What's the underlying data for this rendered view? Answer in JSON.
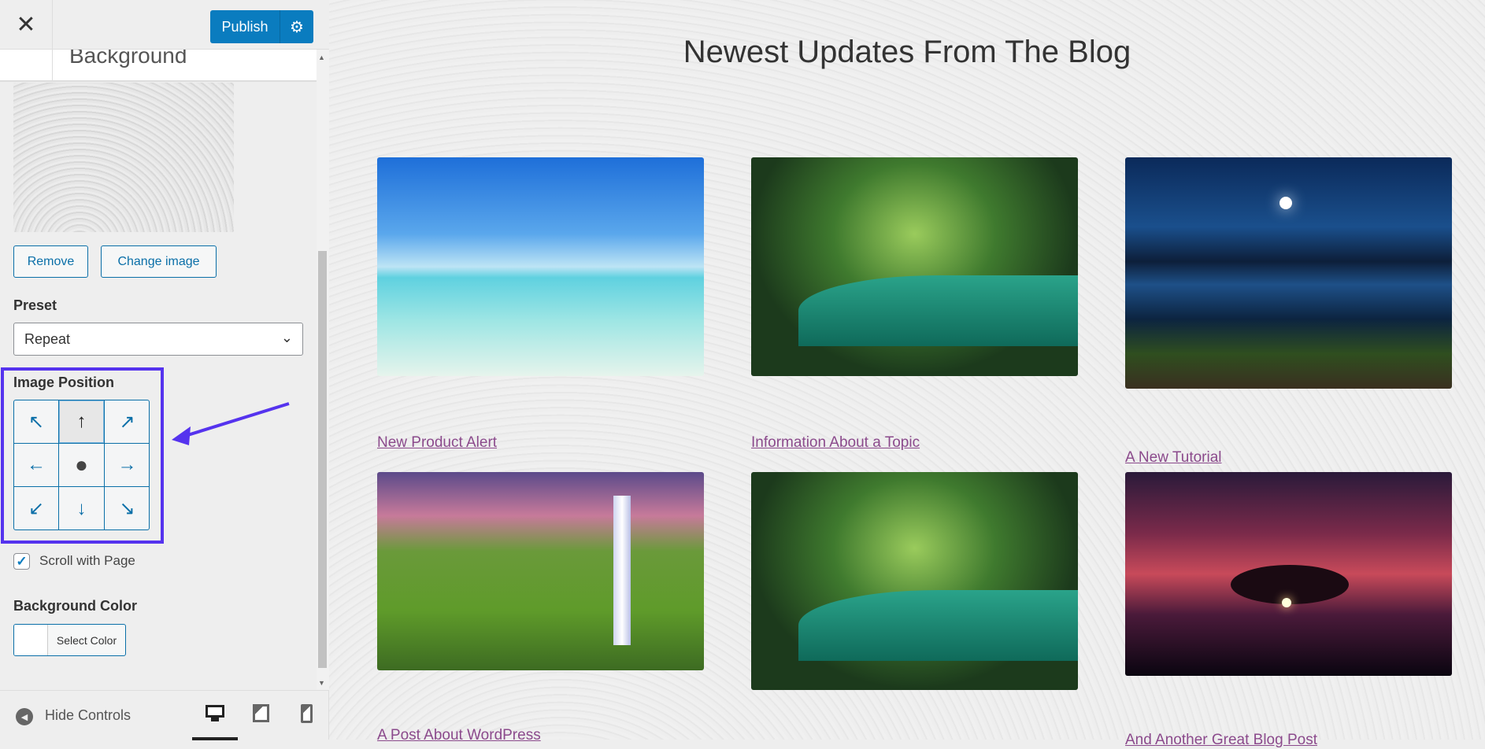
{
  "sidebar": {
    "close_icon": "close-icon",
    "publish_label": "Publish",
    "section_title": "Background",
    "remove_label": "Remove",
    "change_image_label": "Change image",
    "preset_label": "Preset",
    "preset_value": "Repeat",
    "image_position_label": "Image Position",
    "image_position_selected": "top-center",
    "position_cells": [
      "↖",
      "↑",
      "↗",
      "←",
      "●",
      "→",
      "↙",
      "↓",
      "↘"
    ],
    "scroll_with_page_label": "Scroll with Page",
    "scroll_with_page_checked": true,
    "background_color_label": "Background Color",
    "select_color_label": "Select Color",
    "hide_controls_label": "Hide Controls",
    "devices": [
      "desktop",
      "tablet",
      "mobile"
    ],
    "active_device": "desktop"
  },
  "annotation": {
    "highlight_color": "#5533ee"
  },
  "preview": {
    "heading": "Newest Updates From The Blog",
    "posts": [
      {
        "title": "New Product Alert",
        "image": "tropical beach"
      },
      {
        "title": "Information About a Topic",
        "image": "forest river"
      },
      {
        "title": "A New Tutorial",
        "image": "lake pier at night"
      },
      {
        "title": "A Post About WordPress",
        "image": "waterfall"
      },
      {
        "title": "",
        "image": "forest river"
      },
      {
        "title": "And Another Great Blog Post",
        "image": "tree at sunset"
      }
    ]
  },
  "colors": {
    "accent": "#0a7cbf",
    "link": "#8b4a8c"
  }
}
